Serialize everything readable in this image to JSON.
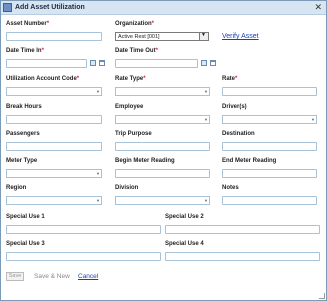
{
  "window": {
    "title": "Add Asset Utilization",
    "close_glyph": "✕"
  },
  "fields": {
    "asset_number": {
      "label": "Asset Number",
      "value": ""
    },
    "organization": {
      "label": "Organization",
      "value": "Active Rest [001]",
      "dropdown_glyph": "▼"
    },
    "verify_asset": "Verify Asset",
    "date_time_in": {
      "label": "Date Time In",
      "value": ""
    },
    "date_time_out": {
      "label": "Date Time Out",
      "value": ""
    },
    "utilization_account_code": {
      "label": "Utilization Account Code",
      "value": ""
    },
    "rate_type": {
      "label": "Rate Type",
      "value": ""
    },
    "rate": {
      "label": "Rate",
      "value": ""
    },
    "break_hours": {
      "label": "Break Hours",
      "value": ""
    },
    "employee": {
      "label": "Employee",
      "value": ""
    },
    "drivers": {
      "label": "Driver(s)",
      "value": ""
    },
    "passengers": {
      "label": "Passengers",
      "value": ""
    },
    "trip_purpose": {
      "label": "Trip Purpose",
      "value": ""
    },
    "destination": {
      "label": "Destination",
      "value": ""
    },
    "meter_type": {
      "label": "Meter Type",
      "value": ""
    },
    "begin_meter_reading": {
      "label": "Begin Meter Reading",
      "value": ""
    },
    "end_meter_reading": {
      "label": "End Meter Reading",
      "value": ""
    },
    "region": {
      "label": "Region",
      "value": ""
    },
    "division": {
      "label": "Division",
      "value": ""
    },
    "notes": {
      "label": "Notes",
      "value": ""
    },
    "special_use_1": {
      "label": "Special Use 1",
      "value": ""
    },
    "special_use_2": {
      "label": "Special Use 2",
      "value": ""
    },
    "special_use_3": {
      "label": "Special Use 3",
      "value": ""
    },
    "special_use_4": {
      "label": "Special Use 4",
      "value": ""
    },
    "required_marker": "*",
    "dropdown_arrow": "▼"
  },
  "actions": {
    "save": "Save",
    "save_new": "Save & New",
    "cancel": "Cancel"
  }
}
